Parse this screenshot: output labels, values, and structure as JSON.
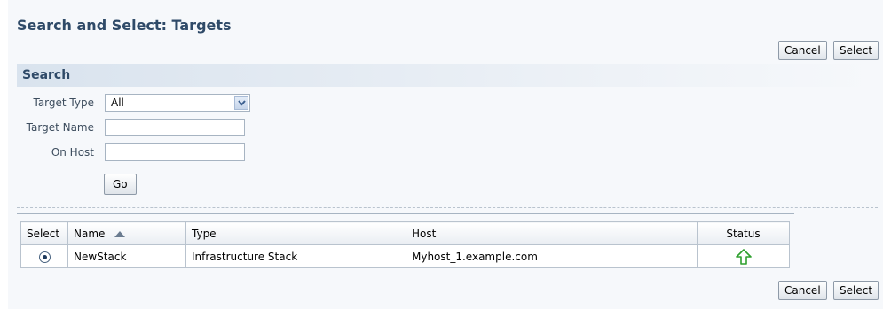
{
  "page": {
    "title": "Search and Select: Targets"
  },
  "actions": {
    "cancel_label": "Cancel",
    "select_label": "Select"
  },
  "search": {
    "title": "Search",
    "target_type_label": "Target Type",
    "target_type_value": "All",
    "target_name_label": "Target Name",
    "target_name_value": "",
    "on_host_label": "On Host",
    "on_host_value": "",
    "go_label": "Go"
  },
  "results": {
    "columns": {
      "select": "Select",
      "name": "Name",
      "type": "Type",
      "host": "Host",
      "status": "Status"
    },
    "sort_indicator": "ascending-triangle-icon",
    "rows": [
      {
        "selected": true,
        "name": "NewStack",
        "type": "Infrastructure Stack",
        "host": "Myhost_1.example.com",
        "status": "up-arrow-icon"
      }
    ]
  },
  "colors": {
    "title": "#2f4a68",
    "status_up": "#2ea02e",
    "header_band": "#d9e3ee"
  }
}
